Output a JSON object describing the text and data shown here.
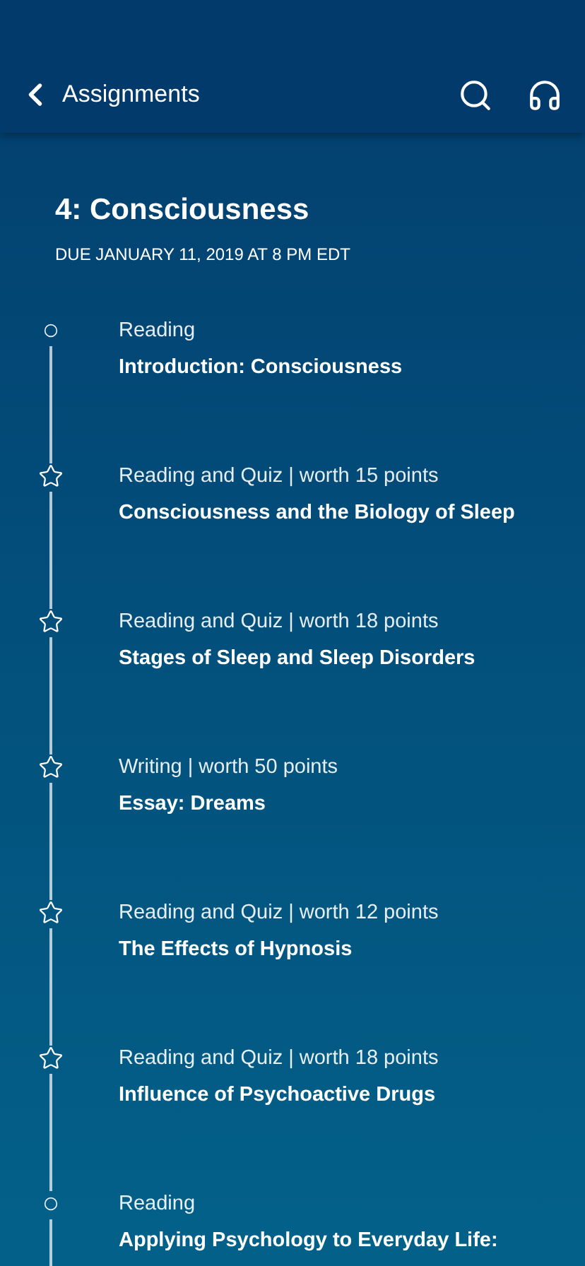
{
  "header": {
    "back_label": "Assignments"
  },
  "module": {
    "title": "4: Consciousness",
    "due": "DUE JANUARY 11, 2019 AT 8 PM EDT"
  },
  "items": [
    {
      "kind": "reading",
      "label": "Reading",
      "title": "Introduction: Consciousness"
    },
    {
      "kind": "graded",
      "label": "Reading and Quiz | worth 15 points",
      "title": "Consciousness and the Biology of Sleep"
    },
    {
      "kind": "graded",
      "label": "Reading and Quiz | worth 18 points",
      "title": "Stages of Sleep and Sleep Disorders"
    },
    {
      "kind": "graded",
      "label": "Writing | worth 50 points",
      "title": "Essay: Dreams"
    },
    {
      "kind": "graded",
      "label": "Reading and Quiz | worth 12 points",
      "title": "The Effects of Hypnosis"
    },
    {
      "kind": "graded",
      "label": "Reading and Quiz | worth 18 points",
      "title": "Influence of Psychoactive Drugs"
    },
    {
      "kind": "reading",
      "label": "Reading",
      "title": "Applying Psychology to Everyday Life:"
    }
  ]
}
